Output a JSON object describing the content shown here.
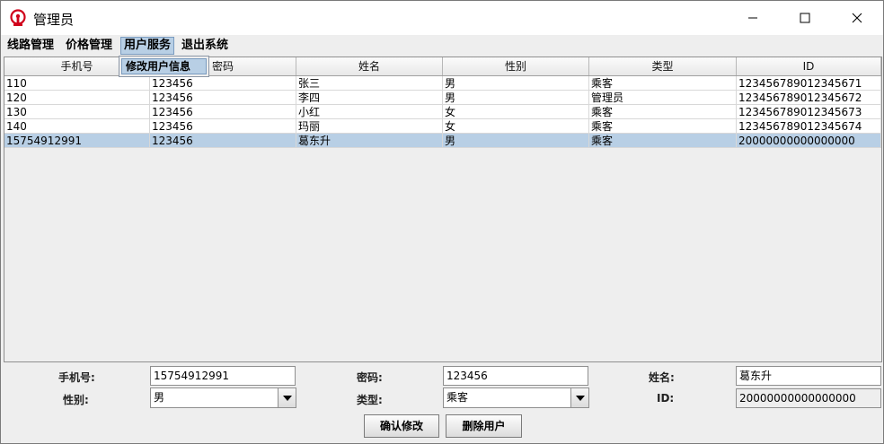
{
  "window": {
    "title": "管理员",
    "accent": "#d0021b"
  },
  "menubar": {
    "items": [
      {
        "label": "线路管理"
      },
      {
        "label": "价格管理"
      },
      {
        "label": "用户服务"
      },
      {
        "label": "退出系统"
      }
    ],
    "active_menu": "用户服务",
    "dropdown": {
      "items": [
        {
          "label": "修改用户信息"
        }
      ]
    }
  },
  "table": {
    "columns": [
      "手机号",
      "密码",
      "姓名",
      "性别",
      "类型",
      "ID"
    ],
    "rows": [
      [
        "110",
        "123456",
        "张三",
        "男",
        "乘客",
        "123456789012345671"
      ],
      [
        "120",
        "123456",
        "李四",
        "男",
        "管理员",
        "123456789012345672"
      ],
      [
        "130",
        "123456",
        "小红",
        "女",
        "乘客",
        "123456789012345673"
      ],
      [
        "140",
        "123456",
        "玛丽",
        "女",
        "乘客",
        "123456789012345674"
      ],
      [
        "15754912991",
        "123456",
        "葛东升",
        "男",
        "乘客",
        "20000000000000000"
      ]
    ],
    "selected_row": 4,
    "selection_color": "#b8cfe5"
  },
  "form": {
    "phone_label": "手机号:",
    "phone_value": "15754912991",
    "password_label": "密码:",
    "password_value": "123456",
    "name_label": "姓名:",
    "name_value": "葛东升",
    "gender_label": "性别:",
    "gender_value": "男",
    "type_label": "类型:",
    "type_value": "乘客",
    "id_label": "ID:",
    "id_value": "20000000000000000"
  },
  "buttons": {
    "confirm_label": "确认修改",
    "delete_label": "删除用户"
  }
}
